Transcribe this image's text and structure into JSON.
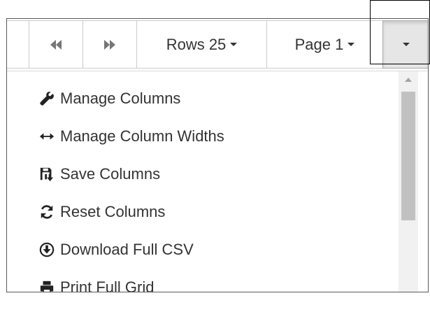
{
  "toolbar": {
    "first_nav_icon": "fast-backward-icon",
    "next_nav_icon": "fast-forward-icon",
    "rows_label": "Rows 25",
    "page_label": "Page 1"
  },
  "menu": {
    "items": [
      {
        "label": "Manage Columns",
        "icon": "wrench-icon"
      },
      {
        "label": "Manage Column Widths",
        "icon": "resize-horizontal-icon"
      },
      {
        "label": "Save Columns",
        "icon": "save-icon"
      },
      {
        "label": "Reset Columns",
        "icon": "refresh-icon"
      },
      {
        "label": "Download Full CSV",
        "icon": "download-circle-icon"
      },
      {
        "label": "Print Full Grid",
        "icon": "print-icon"
      }
    ]
  },
  "colors": {
    "active_button_bg": "#e6e6e6",
    "text": "#333333",
    "border": "#cccccc"
  }
}
